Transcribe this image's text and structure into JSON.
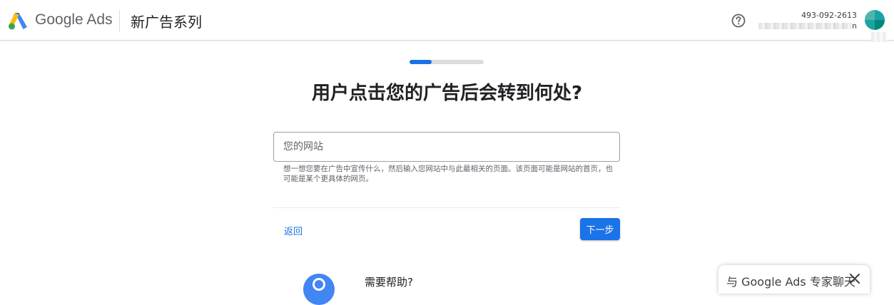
{
  "header": {
    "brand": "Google Ads",
    "page_title": "新广告系列",
    "account_id": "493-092-2613",
    "account_email_suffix": "n"
  },
  "progress": {
    "value_percent": 30
  },
  "main": {
    "question": "用户点击您的广告后会转到何处?",
    "url_placeholder": "您的网站",
    "url_value": "",
    "hint": "想一想您要在广告中宣传什么，然后输入您网站中与此最相关的页面。该页面可能是网站的首页，也可能是某个更具体的网页。",
    "back_label": "返回",
    "next_label": "下一步"
  },
  "help_section": {
    "title": "需要帮助?"
  },
  "chat": {
    "label": "与 Google Ads 专家聊天"
  },
  "colors": {
    "accent": "#1a73e8",
    "logo_blue": "#4285f4",
    "logo_yellow": "#fbbc04",
    "logo_green": "#34a853"
  },
  "icons": {
    "help": "help-circle-icon",
    "close": "close-icon",
    "logo": "google-ads-logo"
  }
}
